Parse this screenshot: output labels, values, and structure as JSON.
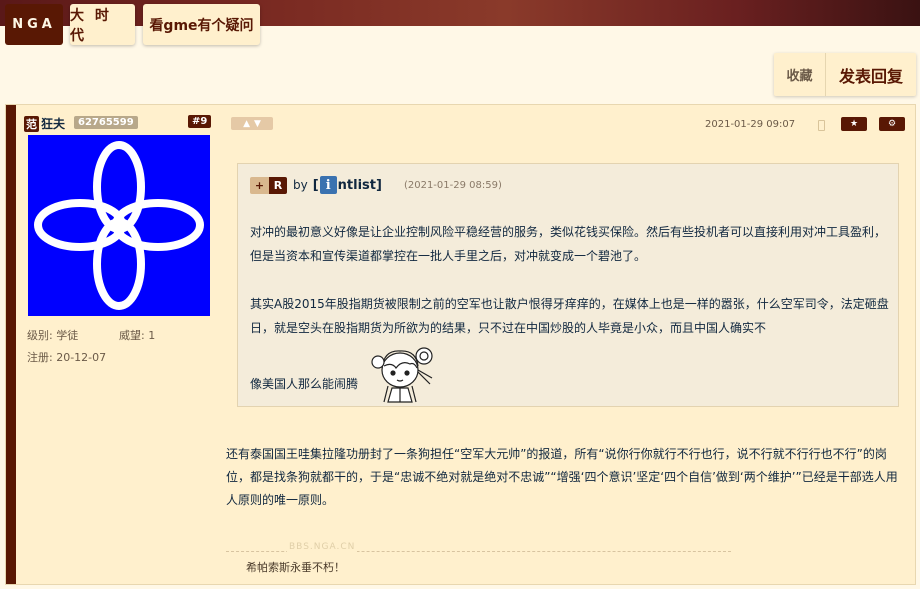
{
  "header": {
    "logo": "NGA",
    "tabs": [
      "大 时 代",
      "看gme有个疑问"
    ]
  },
  "actions": {
    "favorite": "收藏",
    "reply": "发表回复"
  },
  "post": {
    "user": {
      "badge": "范",
      "name": "狂夫",
      "uid": "62765599",
      "level_label": "级别:",
      "level": "学徒",
      "prestige_label": "威望:",
      "prestige": "1",
      "reg_label": "注册:",
      "reg": "20-12-07"
    },
    "floor": "#9",
    "datetime": "2021-01-29 09:07",
    "quote": {
      "plus": "+",
      "r": "R",
      "by": "by",
      "name_prefix": "[",
      "name_icon": "i",
      "name_rest": "ntlist]",
      "time": "(2021-01-29 08:59)",
      "p1": "对冲的最初意义好像是让企业控制风险平稳经营的服务，类似花钱买保险。然后有些投机者可以直接利用对冲工具盈利，但是当资本和宣传渠道都掌控在一批人手里之后，对冲就变成一个碧池了。",
      "p2": "其实A股2015年股指期货被限制之前的空军也让散户恨得牙痒痒的，在媒体上也是一样的嚣张，什么空军司令，法定砸盘日，就是空头在股指期货为所欲为的结果，只不过在中国炒股的人毕竟是小众，而且中国人确实不",
      "p3": "像美国人那么能闹腾"
    },
    "body": "还有泰国国王哇集拉隆功册封了一条狗担任“空军大元帅”的报道，所有“说你行你就行不行也行，说不行就不行行也不行”的岗位，都是找条狗就都干的，于是“忠诚不绝对就是绝对不忠诚”“增强‘四个意识’坚定‘四个自信’做到‘两个维护’”已经是干部选人用人原则的唯一原则。",
    "watermark": "BBS.NGA.CN",
    "signature": "希帕索斯永垂不朽！"
  },
  "icons": [
    "thumbs-up-icon",
    "thumbs-down-icon",
    "phone-icon",
    "star-icon",
    "gear-icon",
    "four-leaf-avatar",
    "chibi-emoticon"
  ]
}
